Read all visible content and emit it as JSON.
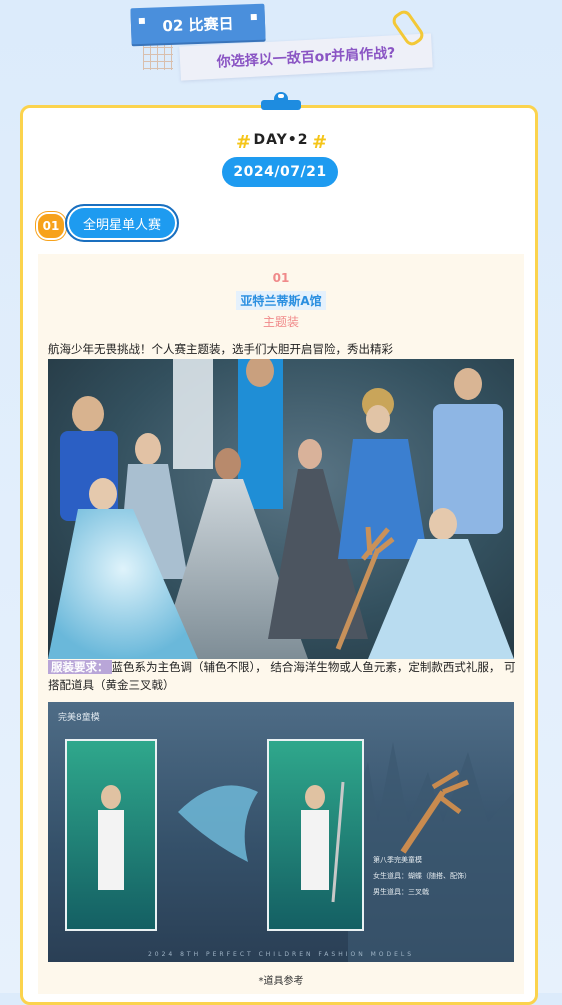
{
  "header": {
    "day_tag": "02 比赛日",
    "subtitle": "你选择以一敌百or并肩作战?"
  },
  "day": {
    "label": "DAY•2",
    "hash": "#",
    "date": "2024/07/21"
  },
  "section": {
    "number": "01",
    "title": "全明星单人赛"
  },
  "entry": {
    "index": "01",
    "venue": "亚特兰蒂斯A馆",
    "theme": "主题装",
    "description": "航海少年无畏挑战！个人赛主题装，选手们大胆开启冒险，秀出精彩",
    "requirement_tag": "服装要求：",
    "requirement_text": "蓝色系为主色调（辅色不限），  结合海洋生物或人鱼元素，定制款西式礼服，  可搭配道具（黄金三叉戟）",
    "reference_note": "*道具参考"
  },
  "reference_image": {
    "watermark": "完美8童模",
    "caption_lines": [
      "第八季完美童模",
      "女生道具：蝴蝶（随搭、配饰）",
      "男生道具：三叉戟"
    ],
    "footer": "2024 8TH PERFECT CHILDREN FASHION MODELS"
  },
  "colors": {
    "accent_blue": "#1e9bf0",
    "gold_border": "#fbd34d",
    "pink_text": "#f08a8a",
    "purple_text": "#8a55c4"
  },
  "icons": [
    "paperclip-icon",
    "pushpin-icon",
    "grid-icon"
  ]
}
